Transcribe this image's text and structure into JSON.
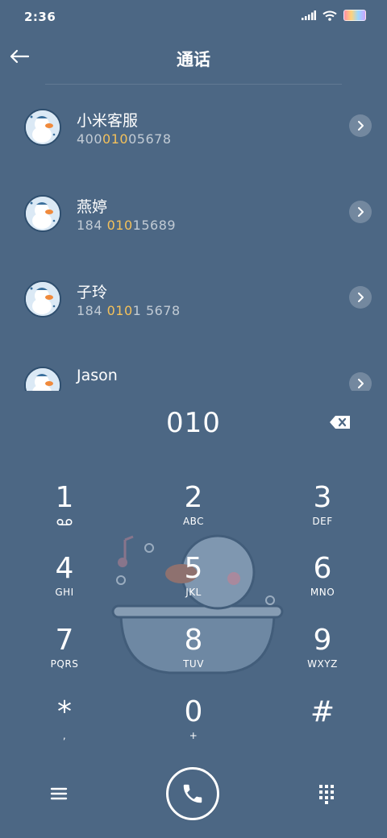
{
  "status": {
    "time": "2:36"
  },
  "header": {
    "title": "通话"
  },
  "contacts": [
    {
      "name": "小米客服",
      "number_before": "400",
      "number_match": "010",
      "number_after": "05678"
    },
    {
      "name": "燕婷",
      "number_before": "184 ",
      "number_match": "010",
      "number_after": "15689"
    },
    {
      "name": "子玲",
      "number_before": "184 ",
      "number_match": "010",
      "number_after": "1 5678"
    },
    {
      "name": "Jason",
      "number_before": "",
      "number_match": "",
      "number_after": ""
    }
  ],
  "dialer": {
    "entered": "010"
  },
  "keypad": [
    {
      "num": "1",
      "letters": ""
    },
    {
      "num": "2",
      "letters": "ABC"
    },
    {
      "num": "3",
      "letters": "DEF"
    },
    {
      "num": "4",
      "letters": "GHI"
    },
    {
      "num": "5",
      "letters": "JKL"
    },
    {
      "num": "6",
      "letters": "MNO"
    },
    {
      "num": "7",
      "letters": "PQRS"
    },
    {
      "num": "8",
      "letters": "TUV"
    },
    {
      "num": "9",
      "letters": "WXYZ"
    },
    {
      "num": "*",
      "letters": ","
    },
    {
      "num": "0",
      "letters": "+"
    },
    {
      "num": "#",
      "letters": ""
    }
  ],
  "colors": {
    "background": "#4c6784",
    "highlight": "#f4c15a"
  },
  "icons": [
    "signal-icon",
    "wifi-icon",
    "battery-icon",
    "back-arrow-icon",
    "chevron-right-icon",
    "backspace-icon",
    "voicemail-icon",
    "menu-icon",
    "phone-icon",
    "dialpad-icon"
  ]
}
